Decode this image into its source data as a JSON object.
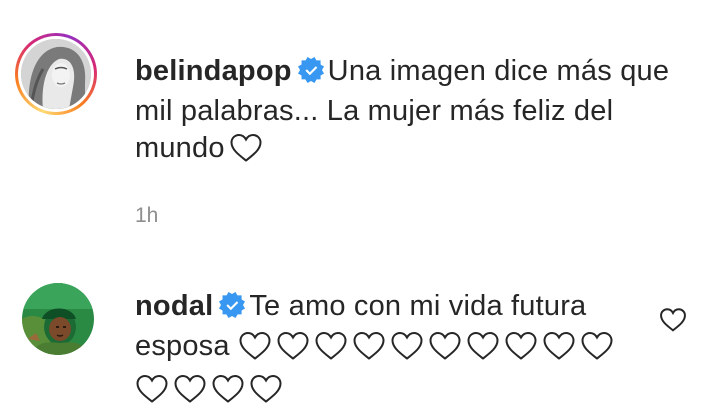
{
  "comments": [
    {
      "username": "belindapop",
      "verified": true,
      "text": "Una imagen dice más que mil palabras... La mujer más feliz del mundo",
      "trailing_hearts": 1,
      "timestamp": "1h",
      "avatar_icon": "profile-photo-woman",
      "has_story_ring": true
    },
    {
      "username": "nodal",
      "verified": true,
      "text": "Te amo con mi vida futura esposa",
      "trailing_hearts": 14,
      "like_icon": "heart-outline-icon",
      "avatar_icon": "profile-photo-green"
    }
  ],
  "colors": {
    "text": "#262626",
    "muted": "#8e8e8e",
    "verified_blue": "#3897f0",
    "avatar_green": "#1f7a3a"
  }
}
